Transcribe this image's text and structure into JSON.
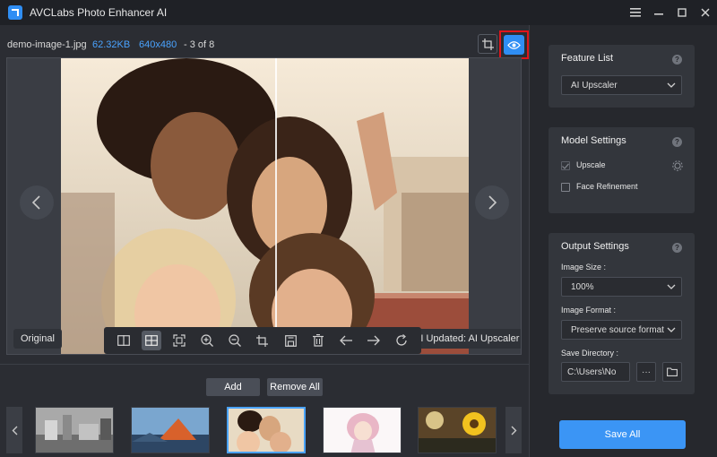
{
  "app": {
    "title": "AVCLabs Photo Enhancer AI",
    "icon": "avclabs-logo-icon",
    "controls": [
      "menu-icon",
      "minimize-icon",
      "maximize-icon",
      "close-icon"
    ]
  },
  "file_info": {
    "name": "demo-image-1.jpg",
    "size": "62.32KB",
    "dimensions": "640x480",
    "position": "- 3 of 8"
  },
  "canvas": {
    "original_label": "Original",
    "updated_label": "AI Updated: AI Upscaler",
    "toolbar_icons": [
      "split-view-icon",
      "side-by-side-icon",
      "fit-screen-icon",
      "zoom-in-icon",
      "zoom-out-icon",
      "crop-icon",
      "save-icon",
      "delete-icon",
      "arrow-left-icon",
      "arrow-right-icon",
      "refresh-icon"
    ],
    "active_tool": "side-by-side-icon"
  },
  "actions": {
    "add_label": "Add",
    "remove_all_label": "Remove All"
  },
  "thumbnails": {
    "items": [
      "city",
      "mountain",
      "selfie",
      "anime",
      "sunflower"
    ],
    "selected_index": 2
  },
  "feature_list": {
    "title": "Feature List",
    "selected": "AI Upscaler"
  },
  "model_settings": {
    "title": "Model Settings",
    "upscale_label": "Upscale",
    "upscale_checked": true,
    "face_refinement_label": "Face Refinement",
    "face_refinement_checked": false
  },
  "output_settings": {
    "title": "Output Settings",
    "image_size_label": "Image Size :",
    "image_size_value": "100%",
    "image_format_label": "Image Format :",
    "image_format_value": "Preserve source format",
    "save_directory_label": "Save Directory :",
    "save_directory_value": "C:\\Users\\No",
    "more_label": "···"
  },
  "save_all_label": "Save All",
  "colors": {
    "accent": "#2f8ef4",
    "highlight_box": "#e0151b",
    "info_blue": "#4aa3ff"
  }
}
